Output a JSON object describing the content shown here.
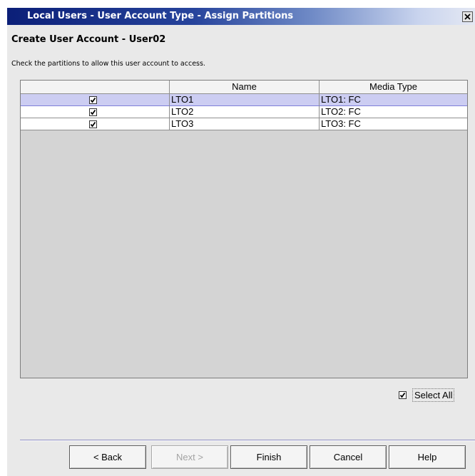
{
  "window": {
    "title": "Local Users - User Account Type - Assign Partitions",
    "close_glyph": "close-icon"
  },
  "dialog": {
    "heading": "Create User Account - User02",
    "instruction": "Check the partitions to allow this user account to access."
  },
  "table": {
    "columns": [
      "",
      "Name",
      "Media Type"
    ],
    "rows": [
      {
        "checked": true,
        "name": "LTO1",
        "media_type": "LTO1: FC",
        "selected": true
      },
      {
        "checked": true,
        "name": "LTO2",
        "media_type": "LTO2: FC",
        "selected": false
      },
      {
        "checked": true,
        "name": "LTO3",
        "media_type": "LTO3: FC",
        "selected": false
      }
    ]
  },
  "select_all": {
    "label": "Select All",
    "checked": true
  },
  "buttons": {
    "back": "< Back",
    "next": "Next >",
    "finish": "Finish",
    "cancel": "Cancel",
    "help": "Help"
  },
  "colors": {
    "titlebar_start": "#0b1f78",
    "selected_row": "#cccdf2",
    "window_bg": "#e9e9e9"
  }
}
